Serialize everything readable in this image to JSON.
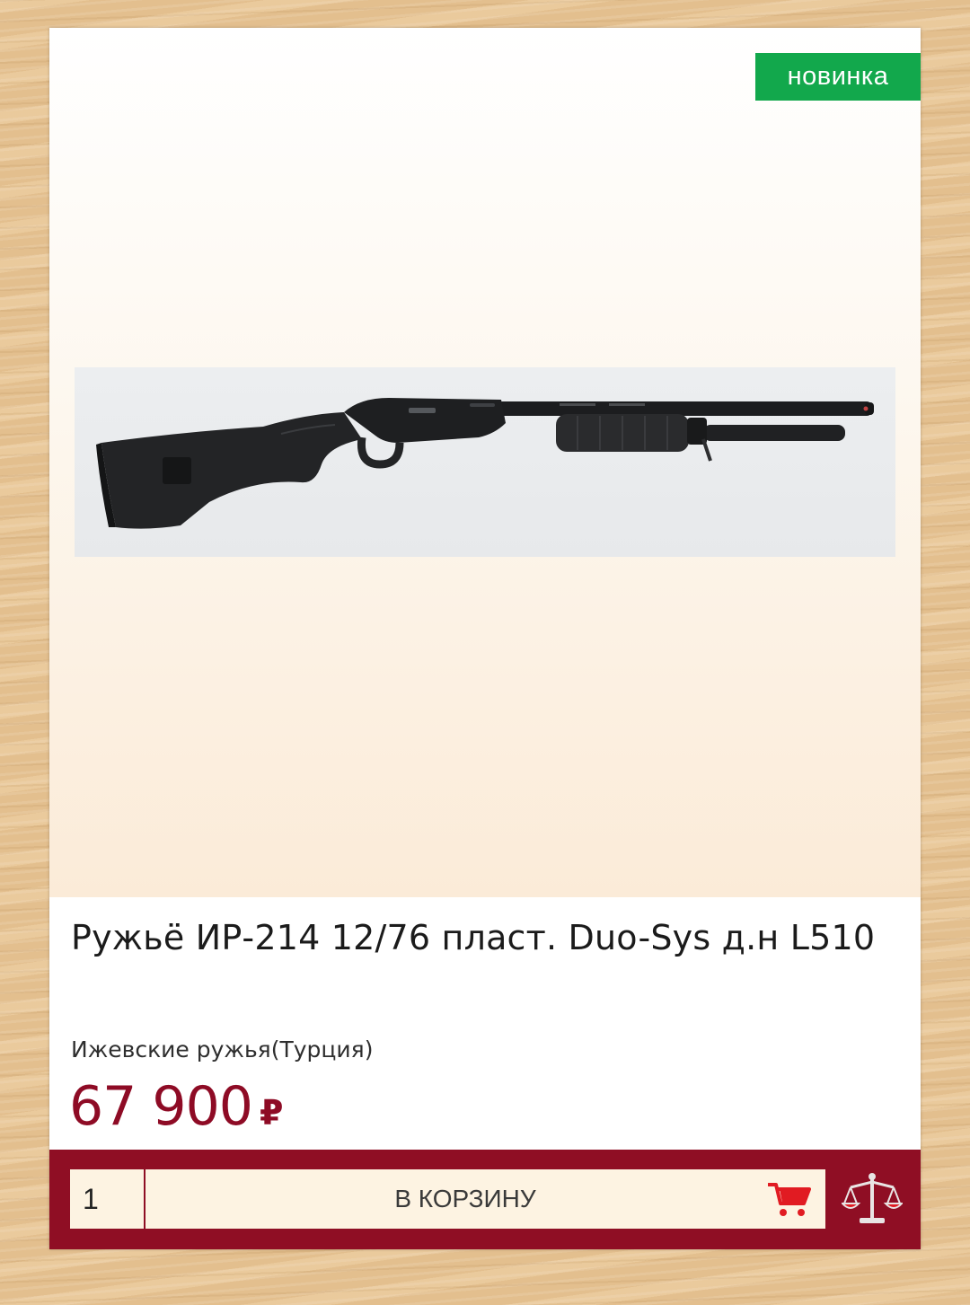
{
  "product": {
    "badge": "новинка",
    "title": "Ружьё ИР-214 12/76 пласт. Duo-Sys д.н L510",
    "manufacturer": "Ижевские ружья(Турция)",
    "price_value": "67 900",
    "price_currency": "₽"
  },
  "purchase": {
    "quantity": "1",
    "add_to_cart_label": "В КОРЗИНУ"
  },
  "icons": {
    "cart": "shopping-cart-icon",
    "compare": "scales-icon"
  },
  "colors": {
    "badge_green": "#12a84c",
    "brand_maroon": "#8f0e24",
    "cart_icon_red": "#e11b22",
    "button_background": "#fdf3e2"
  }
}
